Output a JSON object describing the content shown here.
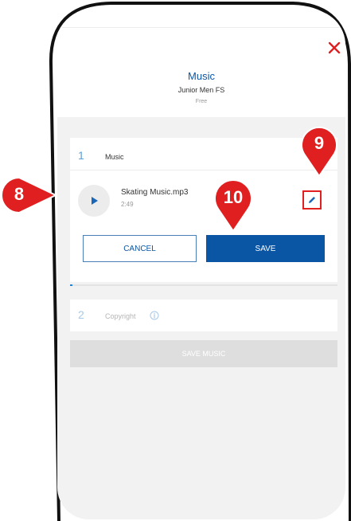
{
  "dialog": {
    "title": "Music",
    "subtitle": "Junior Men FS",
    "segment": "Free"
  },
  "steps": [
    {
      "number": "1",
      "label": "Music"
    },
    {
      "number": "2",
      "label": "Copyright"
    }
  ],
  "track": {
    "file_name": "Skating Music.mp3",
    "duration": "2:49"
  },
  "buttons": {
    "cancel": "CANCEL",
    "save": "SAVE",
    "save_music": "SAVE MUSIC"
  },
  "progress_fraction": 0.01,
  "callouts": [
    "8",
    "9",
    "10"
  ],
  "icons": [
    "close-icon",
    "play-icon",
    "pencil-icon",
    "info-icon"
  ],
  "colors": {
    "accent": "#0b56a4",
    "callout": "#e02020",
    "close": "#e02020"
  }
}
